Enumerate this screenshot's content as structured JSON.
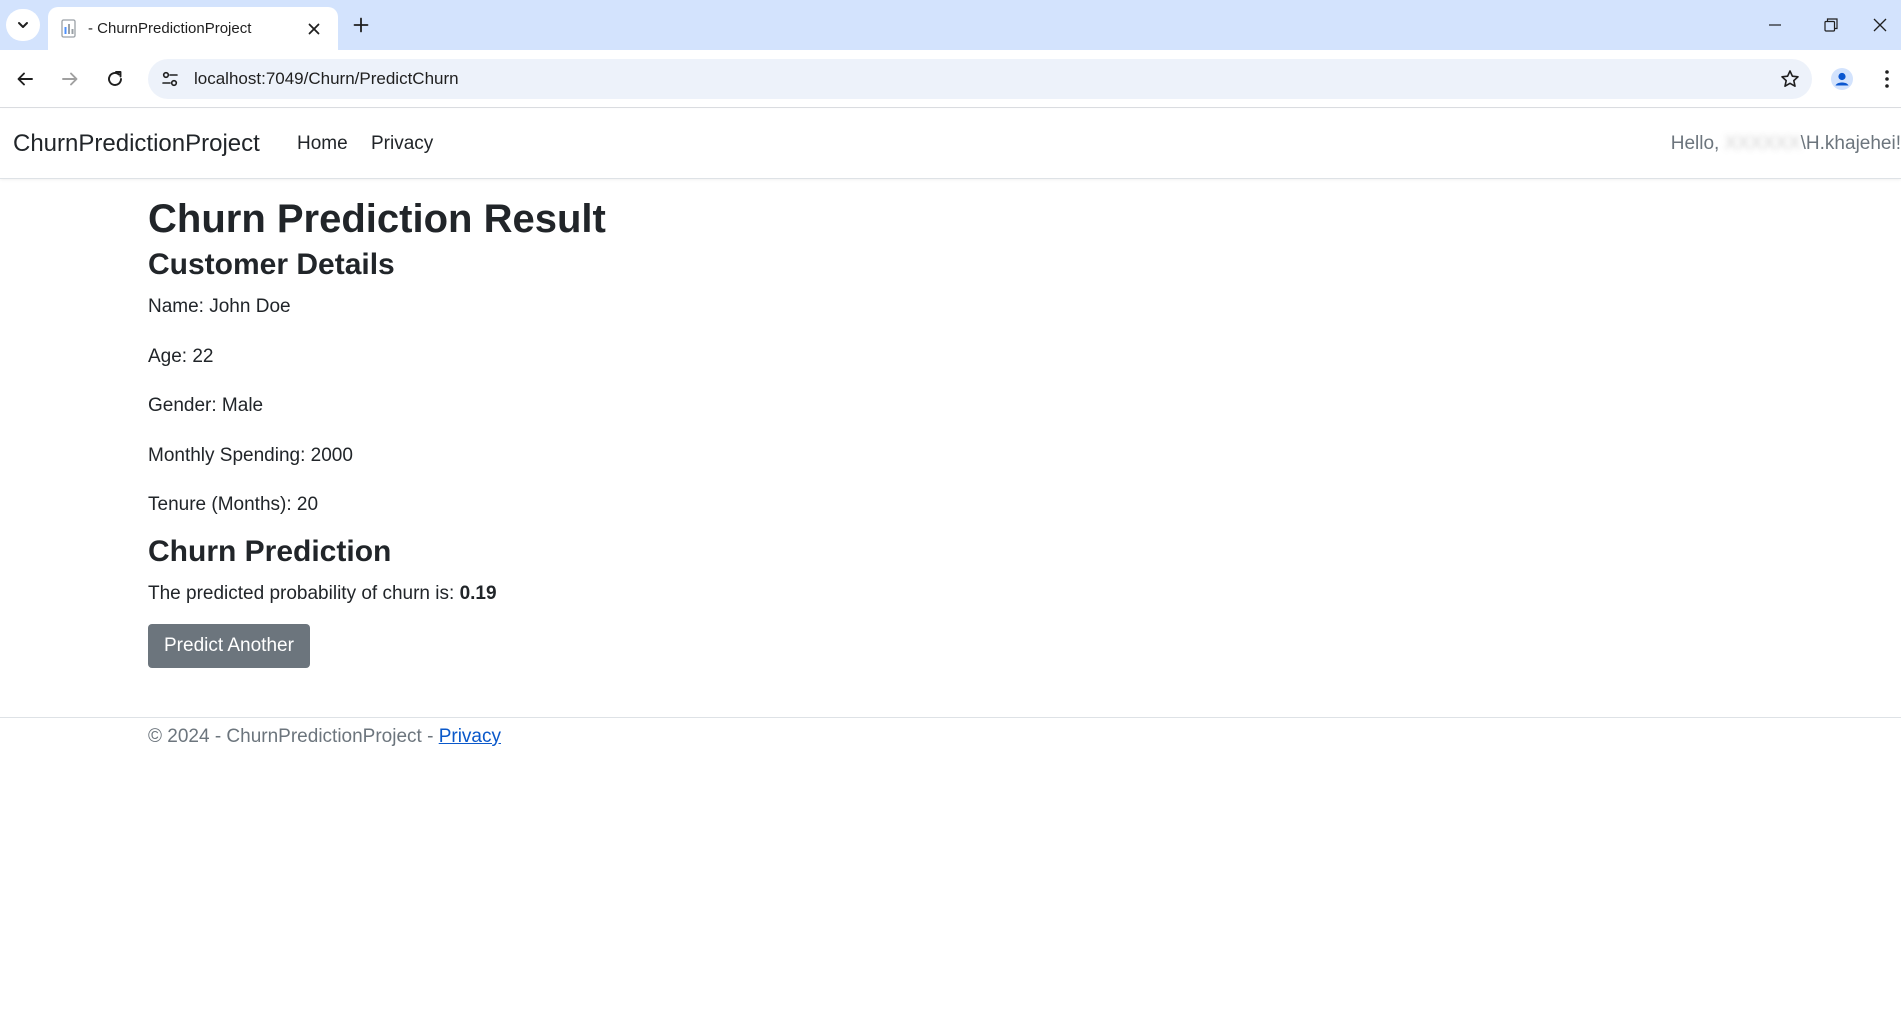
{
  "browser": {
    "tab_title": "- ChurnPredictionProject",
    "url": "localhost:7049/Churn/PredictChurn"
  },
  "site": {
    "brand": "ChurnPredictionProject",
    "nav": [
      {
        "label": "Home"
      },
      {
        "label": "Privacy"
      }
    ],
    "greeting_prefix": "Hello,",
    "greeting_user_visible": "\\H.khajehei!"
  },
  "main": {
    "title": "Churn Prediction Result",
    "details_heading": "Customer Details",
    "details": [
      {
        "text": "Name: John Doe"
      },
      {
        "text": "Age: 22"
      },
      {
        "text": "Gender: Male"
      },
      {
        "text": "Monthly Spending: 2000"
      },
      {
        "text": "Tenure (Months): 20"
      }
    ],
    "prediction_heading": "Churn Prediction",
    "prediction_text": "The predicted probability of churn is: ",
    "prediction_value": "0.19",
    "predict_button": "Predict Another"
  },
  "footer": {
    "text": "© 2024 - ChurnPredictionProject - ",
    "privacy_link": "Privacy"
  },
  "colors": {
    "tabstrip": "#d3e3fd",
    "omnibox": "#edf2fa",
    "button_secondary": "#6c757d",
    "link": "#0a58ca",
    "muted_text": "#6c757d"
  }
}
